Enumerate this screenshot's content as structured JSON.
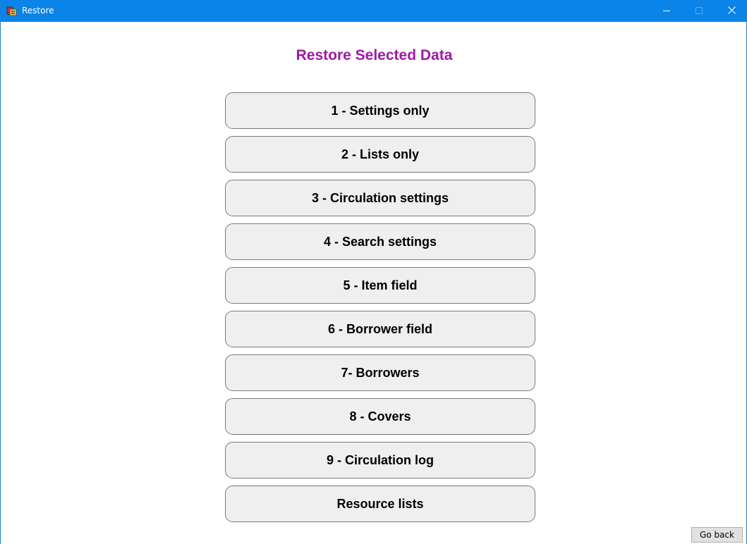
{
  "window": {
    "title": "Restore",
    "title_bar_color": "#0a84e8",
    "icons": {
      "app": "restore-app-icon",
      "minimize": "minimize-icon",
      "maximize": "maximize-icon",
      "close": "close-icon"
    }
  },
  "main": {
    "heading": "Restore Selected Data",
    "heading_color": "#9c1aa6",
    "options": [
      {
        "label": "1 - Settings only"
      },
      {
        "label": "2 - Lists only"
      },
      {
        "label": "3 - Circulation settings"
      },
      {
        "label": "4 - Search settings"
      },
      {
        "label": "5 - Item field"
      },
      {
        "label": "6 - Borrower field"
      },
      {
        "label": "7- Borrowers"
      },
      {
        "label": "8 - Covers"
      },
      {
        "label": "9 - Circulation log"
      },
      {
        "label": "Resource lists"
      }
    ]
  },
  "footer": {
    "go_back_label": "Go back"
  }
}
